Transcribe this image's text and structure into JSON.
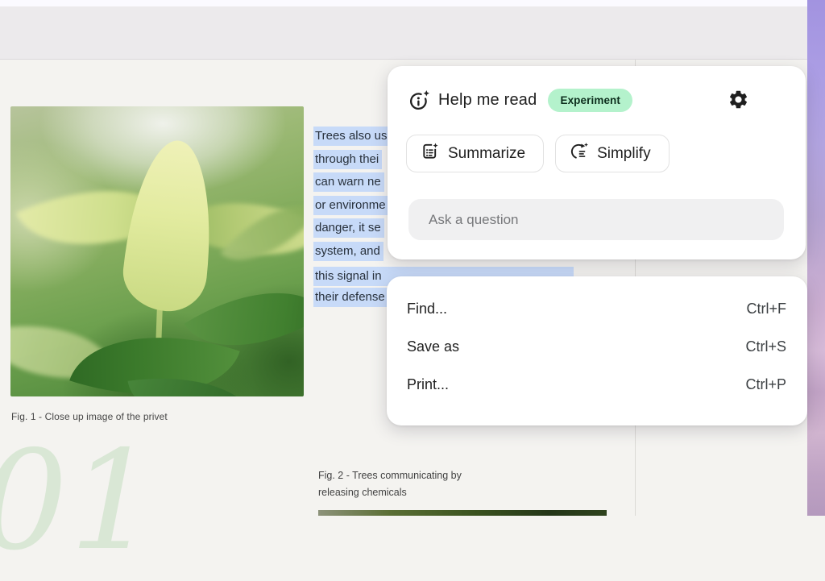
{
  "help_panel": {
    "title": "Help me read",
    "badge": "Experiment",
    "title_icon": "info-sparkle-icon",
    "settings_icon": "gear-icon",
    "buttons": [
      {
        "label": "Summarize",
        "icon": "summarize-doc-sparkle-icon"
      },
      {
        "label": "Simplify",
        "icon": "simplify-arrow-sparkle-icon"
      }
    ],
    "input_placeholder": "Ask a question"
  },
  "context_menu": {
    "items": [
      {
        "label": "Find...",
        "shortcut": "Ctrl+F"
      },
      {
        "label": "Save as",
        "shortcut": "Ctrl+S"
      },
      {
        "label": "Print...",
        "shortcut": "Ctrl+P"
      }
    ]
  },
  "document": {
    "selected_lines": [
      "Trees also us",
      "through thei",
      "can warn ne",
      "or environme",
      "danger, it se",
      "system, and",
      "this signal in",
      "their defense"
    ],
    "fig1_caption": "Fig. 1 - Close up image of the privet",
    "fig2_caption_line1": "Fig. 2 - Trees communicating by",
    "fig2_caption_line2": "releasing chemicals",
    "page_number": "01"
  },
  "colors": {
    "selection_highlight": "#c7daf8",
    "badge_background": "#b4f2cc",
    "badge_text": "#0d2e1d",
    "panel_background": "#ffffff",
    "input_background": "#f0f0f1",
    "page_background": "#f4f3f0",
    "topbar_background": "#eceaec",
    "wallpaper_top": "#a293e0",
    "wallpaper_bottom": "#b499bd",
    "ghost_number_green": "#d9e7d5"
  }
}
